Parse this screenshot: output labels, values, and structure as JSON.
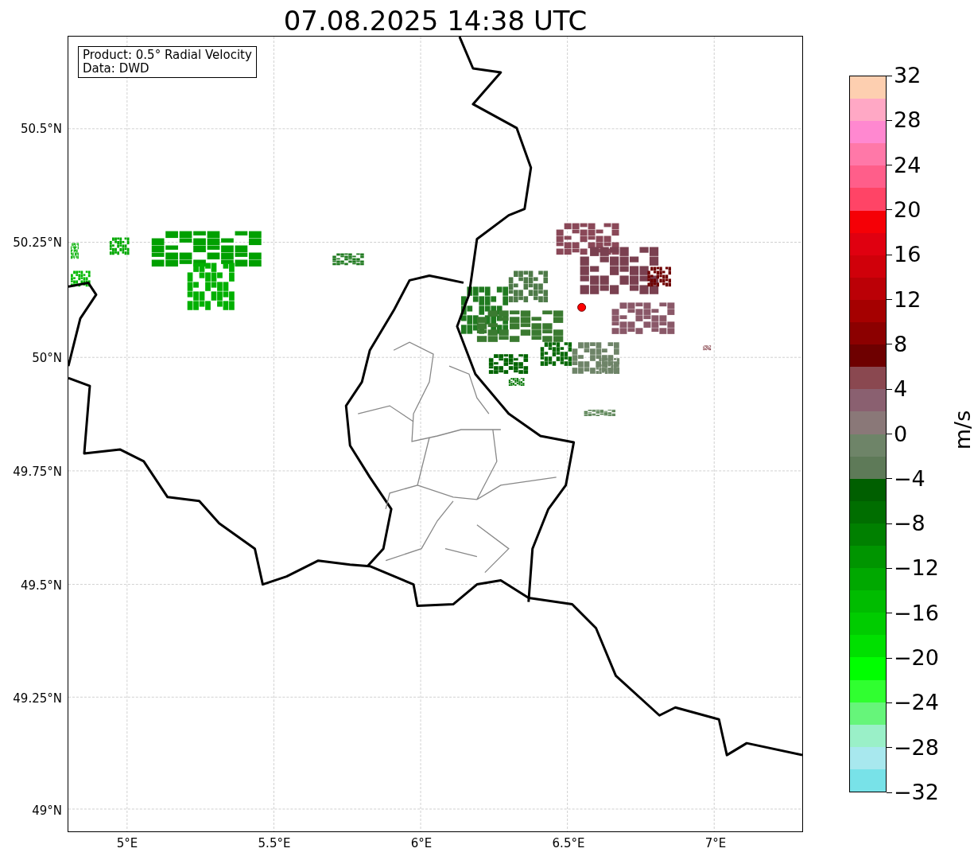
{
  "title": "07.08.2025 14:38 UTC",
  "info_box": {
    "lines": [
      "Product: 0.5° Radial Velocity",
      "Data: DWD"
    ]
  },
  "map": {
    "y_ticks": [
      {
        "label": "50.5°N"
      },
      {
        "label": "50.25°N"
      },
      {
        "label": "50°N"
      },
      {
        "label": "49.75°N"
      },
      {
        "label": "49.5°N"
      },
      {
        "label": "49.25°N"
      },
      {
        "label": "49°N"
      }
    ],
    "x_ticks": [
      {
        "label": "5°E"
      },
      {
        "label": "5.5°E"
      },
      {
        "label": "6°E"
      },
      {
        "label": "6.5°E"
      },
      {
        "label": "7°E"
      }
    ]
  },
  "colorbar": {
    "label": "m/s",
    "ticks": [
      "32",
      "28",
      "24",
      "20",
      "16",
      "12",
      "8",
      "4",
      "0",
      "−4",
      "−8",
      "−12",
      "−16",
      "−20",
      "−24",
      "−28",
      "−32"
    ],
    "segments": [
      {
        "color": "#fdcfb0"
      },
      {
        "color": "#ffa8c5"
      },
      {
        "color": "#ff88d0"
      },
      {
        "color": "#ff78a8"
      },
      {
        "color": "#ff5e8a"
      },
      {
        "color": "#ff4466"
      },
      {
        "color": "#f50006"
      },
      {
        "color": "#e00010"
      },
      {
        "color": "#d0000a"
      },
      {
        "color": "#bb0006"
      },
      {
        "color": "#a50000"
      },
      {
        "color": "#8c0000"
      },
      {
        "color": "#6e0000"
      },
      {
        "color": "#8a4850"
      },
      {
        "color": "#8a6070"
      },
      {
        "color": "#8a7878"
      },
      {
        "color": "#6e8468"
      },
      {
        "color": "#5e7a58"
      },
      {
        "color": "#005f00"
      },
      {
        "color": "#006e00"
      },
      {
        "color": "#008000"
      },
      {
        "color": "#009500"
      },
      {
        "color": "#00a800"
      },
      {
        "color": "#00bc00"
      },
      {
        "color": "#00cc00"
      },
      {
        "color": "#00e000"
      },
      {
        "color": "#00ff00"
      },
      {
        "color": "#30ff30"
      },
      {
        "color": "#66f57a"
      },
      {
        "color": "#9af0c8"
      },
      {
        "color": "#a8e8ee"
      },
      {
        "color": "#78e2e8"
      }
    ]
  }
}
